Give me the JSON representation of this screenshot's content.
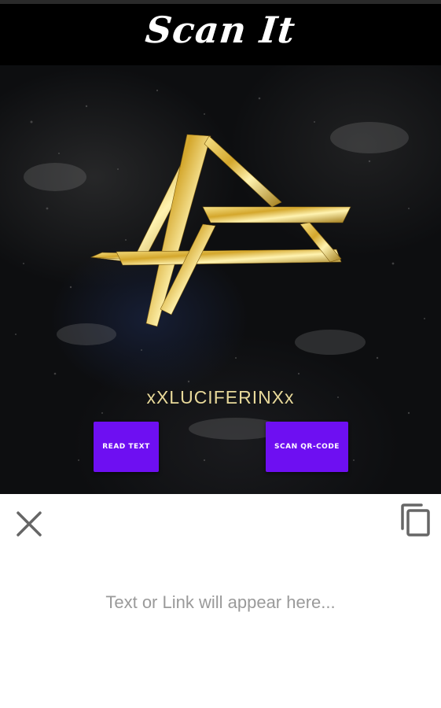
{
  "app": {
    "title": "Scan It"
  },
  "profile": {
    "username": "xXLUCIFERINXx"
  },
  "actions": {
    "read_text_label": "READ TEXT",
    "scan_qr_label": "SCAN QR-CODE"
  },
  "result_sheet": {
    "placeholder_text": "Text or Link will appear here..."
  },
  "colors": {
    "accent_button": "#6e0ff2",
    "header_background": "#000000",
    "logo_gold": "#d4a72c",
    "username_text": "#e8d99a",
    "placeholder_text": "#9a9a9a"
  },
  "icons": [
    "close-icon",
    "copy-icon"
  ]
}
